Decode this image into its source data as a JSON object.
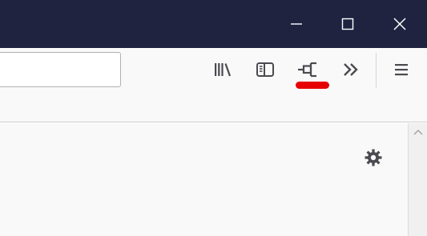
{
  "window": {
    "controls": {
      "minimize_icon": "minimize-icon",
      "maximize_icon": "maximize-icon",
      "close_icon": "close-icon"
    }
  },
  "toolbar": {
    "url": "",
    "buttons": [
      {
        "icon": "library-icon"
      },
      {
        "icon": "sidebar-icon"
      },
      {
        "icon": "pin-icon",
        "highlighted": true,
        "highlight_color": "#e60000"
      },
      {
        "icon": "overflow-chevrons-icon"
      },
      {
        "icon": "hamburger-menu-icon"
      }
    ]
  },
  "content": {
    "settings_icon": "gear-icon"
  },
  "colors": {
    "titlebar": "#202340",
    "toolbar": "#f9f9fa",
    "icon": "#4a4a4f",
    "highlight": "#e60000"
  }
}
